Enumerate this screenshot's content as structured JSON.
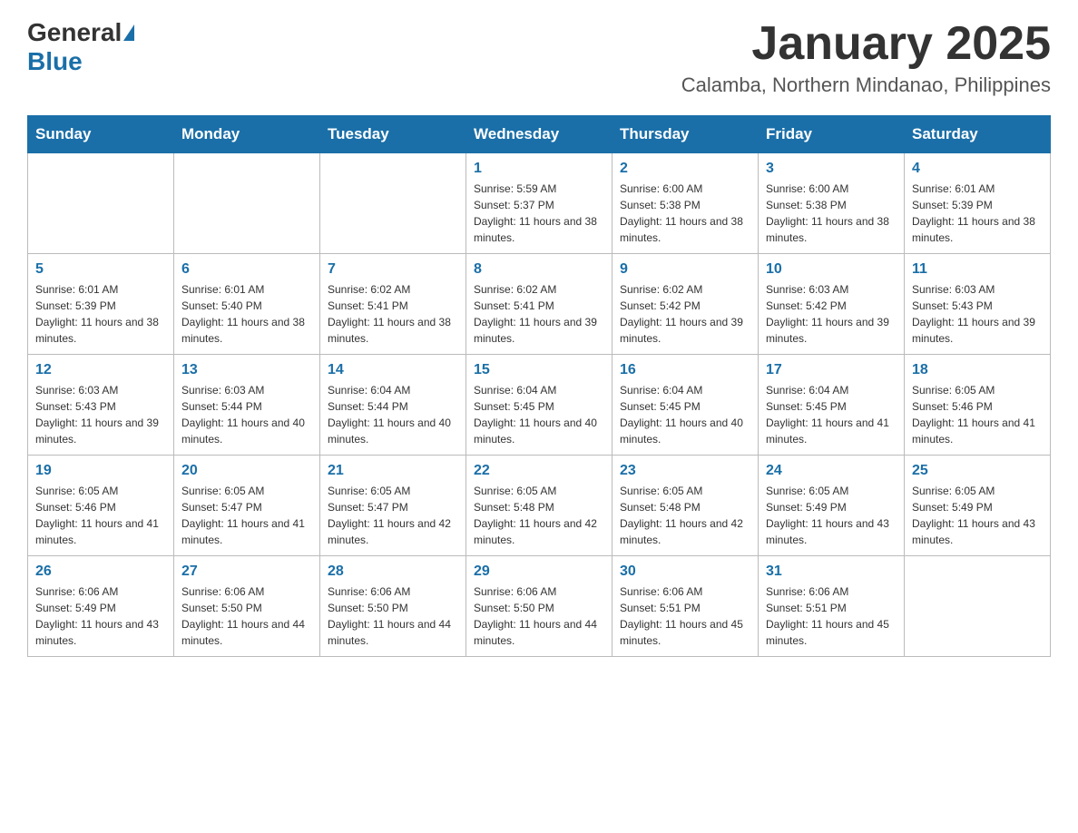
{
  "header": {
    "logo_general": "General",
    "logo_blue": "Blue",
    "month_title": "January 2025",
    "subtitle": "Calamba, Northern Mindanao, Philippines"
  },
  "weekdays": [
    "Sunday",
    "Monday",
    "Tuesday",
    "Wednesday",
    "Thursday",
    "Friday",
    "Saturday"
  ],
  "weeks": [
    [
      {
        "day": "",
        "info": ""
      },
      {
        "day": "",
        "info": ""
      },
      {
        "day": "",
        "info": ""
      },
      {
        "day": "1",
        "info": "Sunrise: 5:59 AM\nSunset: 5:37 PM\nDaylight: 11 hours and 38 minutes."
      },
      {
        "day": "2",
        "info": "Sunrise: 6:00 AM\nSunset: 5:38 PM\nDaylight: 11 hours and 38 minutes."
      },
      {
        "day": "3",
        "info": "Sunrise: 6:00 AM\nSunset: 5:38 PM\nDaylight: 11 hours and 38 minutes."
      },
      {
        "day": "4",
        "info": "Sunrise: 6:01 AM\nSunset: 5:39 PM\nDaylight: 11 hours and 38 minutes."
      }
    ],
    [
      {
        "day": "5",
        "info": "Sunrise: 6:01 AM\nSunset: 5:39 PM\nDaylight: 11 hours and 38 minutes."
      },
      {
        "day": "6",
        "info": "Sunrise: 6:01 AM\nSunset: 5:40 PM\nDaylight: 11 hours and 38 minutes."
      },
      {
        "day": "7",
        "info": "Sunrise: 6:02 AM\nSunset: 5:41 PM\nDaylight: 11 hours and 38 minutes."
      },
      {
        "day": "8",
        "info": "Sunrise: 6:02 AM\nSunset: 5:41 PM\nDaylight: 11 hours and 39 minutes."
      },
      {
        "day": "9",
        "info": "Sunrise: 6:02 AM\nSunset: 5:42 PM\nDaylight: 11 hours and 39 minutes."
      },
      {
        "day": "10",
        "info": "Sunrise: 6:03 AM\nSunset: 5:42 PM\nDaylight: 11 hours and 39 minutes."
      },
      {
        "day": "11",
        "info": "Sunrise: 6:03 AM\nSunset: 5:43 PM\nDaylight: 11 hours and 39 minutes."
      }
    ],
    [
      {
        "day": "12",
        "info": "Sunrise: 6:03 AM\nSunset: 5:43 PM\nDaylight: 11 hours and 39 minutes."
      },
      {
        "day": "13",
        "info": "Sunrise: 6:03 AM\nSunset: 5:44 PM\nDaylight: 11 hours and 40 minutes."
      },
      {
        "day": "14",
        "info": "Sunrise: 6:04 AM\nSunset: 5:44 PM\nDaylight: 11 hours and 40 minutes."
      },
      {
        "day": "15",
        "info": "Sunrise: 6:04 AM\nSunset: 5:45 PM\nDaylight: 11 hours and 40 minutes."
      },
      {
        "day": "16",
        "info": "Sunrise: 6:04 AM\nSunset: 5:45 PM\nDaylight: 11 hours and 40 minutes."
      },
      {
        "day": "17",
        "info": "Sunrise: 6:04 AM\nSunset: 5:45 PM\nDaylight: 11 hours and 41 minutes."
      },
      {
        "day": "18",
        "info": "Sunrise: 6:05 AM\nSunset: 5:46 PM\nDaylight: 11 hours and 41 minutes."
      }
    ],
    [
      {
        "day": "19",
        "info": "Sunrise: 6:05 AM\nSunset: 5:46 PM\nDaylight: 11 hours and 41 minutes."
      },
      {
        "day": "20",
        "info": "Sunrise: 6:05 AM\nSunset: 5:47 PM\nDaylight: 11 hours and 41 minutes."
      },
      {
        "day": "21",
        "info": "Sunrise: 6:05 AM\nSunset: 5:47 PM\nDaylight: 11 hours and 42 minutes."
      },
      {
        "day": "22",
        "info": "Sunrise: 6:05 AM\nSunset: 5:48 PM\nDaylight: 11 hours and 42 minutes."
      },
      {
        "day": "23",
        "info": "Sunrise: 6:05 AM\nSunset: 5:48 PM\nDaylight: 11 hours and 42 minutes."
      },
      {
        "day": "24",
        "info": "Sunrise: 6:05 AM\nSunset: 5:49 PM\nDaylight: 11 hours and 43 minutes."
      },
      {
        "day": "25",
        "info": "Sunrise: 6:05 AM\nSunset: 5:49 PM\nDaylight: 11 hours and 43 minutes."
      }
    ],
    [
      {
        "day": "26",
        "info": "Sunrise: 6:06 AM\nSunset: 5:49 PM\nDaylight: 11 hours and 43 minutes."
      },
      {
        "day": "27",
        "info": "Sunrise: 6:06 AM\nSunset: 5:50 PM\nDaylight: 11 hours and 44 minutes."
      },
      {
        "day": "28",
        "info": "Sunrise: 6:06 AM\nSunset: 5:50 PM\nDaylight: 11 hours and 44 minutes."
      },
      {
        "day": "29",
        "info": "Sunrise: 6:06 AM\nSunset: 5:50 PM\nDaylight: 11 hours and 44 minutes."
      },
      {
        "day": "30",
        "info": "Sunrise: 6:06 AM\nSunset: 5:51 PM\nDaylight: 11 hours and 45 minutes."
      },
      {
        "day": "31",
        "info": "Sunrise: 6:06 AM\nSunset: 5:51 PM\nDaylight: 11 hours and 45 minutes."
      },
      {
        "day": "",
        "info": ""
      }
    ]
  ]
}
